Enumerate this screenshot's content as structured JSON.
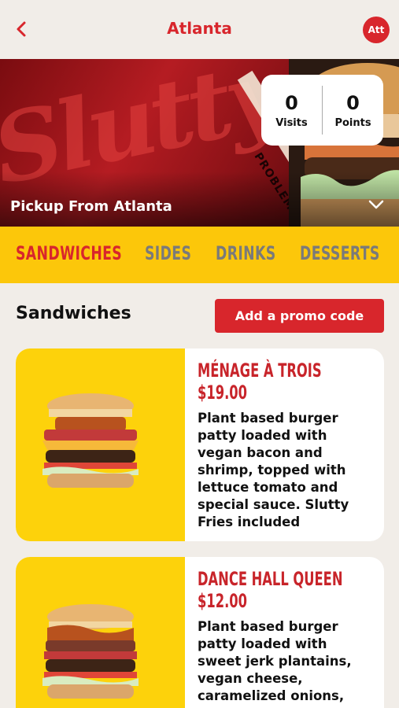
{
  "header": {
    "title": "Atlanta",
    "avatar_initials": "Att",
    "back_icon": "chevron-left-icon"
  },
  "hero": {
    "pickup_label": "Pickup From Atlanta",
    "stripe_text": "PROBLEMS A",
    "stats": [
      {
        "value": "0",
        "label": "Visits"
      },
      {
        "value": "0",
        "label": "Points"
      }
    ],
    "expand_icon": "chevron-down-icon"
  },
  "tabs": [
    {
      "label": "SANDWICHES",
      "active": true
    },
    {
      "label": "SIDES",
      "active": false
    },
    {
      "label": "DRINKS",
      "active": false
    },
    {
      "label": "DESSERTS",
      "active": false
    }
  ],
  "section": {
    "title": "Sandwiches",
    "promo_label": "Add a promo code"
  },
  "products": [
    {
      "name": "MÉNAGE À TROIS",
      "price": "$19.00",
      "description": "Plant based burger patty loaded with vegan bacon and shrimp, topped with lettuce tomato and special sauce. Slutty Fries included"
    },
    {
      "name": "DANCE HALL QUEEN",
      "price": "$12.00",
      "description": "Plant based burger patty loaded with sweet jerk plantains, vegan cheese, caramelized onions,"
    }
  ],
  "colors": {
    "brand_red": "#d8262c",
    "tab_yellow": "#fcc70a",
    "card_yellow": "#fdd20b",
    "background": "#f1ede8"
  }
}
